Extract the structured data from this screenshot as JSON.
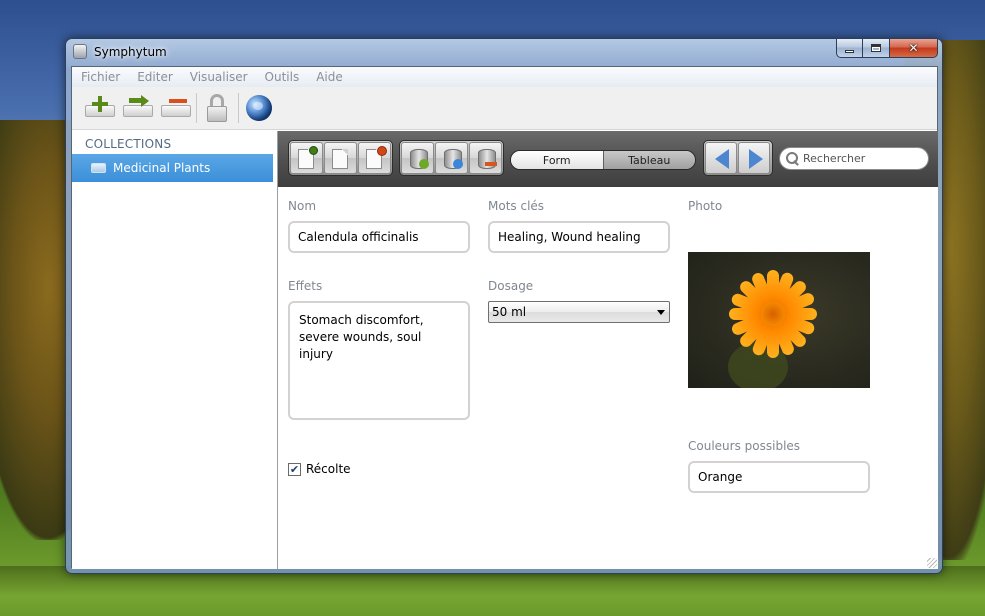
{
  "window": {
    "title": "Symphytum",
    "controls": {
      "minimize_icon": "minimize-icon",
      "maximize_icon": "maximize-icon",
      "close_icon": "close-icon"
    }
  },
  "menubar": {
    "items": [
      "Fichier",
      "Editer",
      "Visualiser",
      "Outils",
      "Aide"
    ]
  },
  "toolbar": {
    "buttons": [
      {
        "icon": "add-collection-icon"
      },
      {
        "icon": "move-collection-icon"
      },
      {
        "icon": "remove-collection-icon"
      },
      {
        "icon": "lock-icon"
      },
      {
        "icon": "globe-icon"
      }
    ]
  },
  "sidebar": {
    "header": "COLLECTIONS",
    "items": [
      {
        "label": "Medicinal Plants",
        "icon": "collection-icon",
        "selected": true
      }
    ],
    "selected_color": "#3b8fd8"
  },
  "panelbar": {
    "record_buttons": [
      "new-record-icon",
      "duplicate-record-icon",
      "delete-record-icon"
    ],
    "field_buttons": [
      "add-field-icon",
      "edit-field-icon",
      "remove-field-icon"
    ],
    "view_toggle": {
      "options": [
        "Form",
        "Tableau"
      ],
      "selected": "Form"
    },
    "nav": {
      "prev_icon": "arrow-left-icon",
      "next_icon": "arrow-right-icon"
    },
    "search": {
      "placeholder": "Rechercher",
      "icon": "search-icon"
    }
  },
  "form": {
    "nom": {
      "label": "Nom",
      "value": "Calendula officinalis"
    },
    "mots_cles": {
      "label": "Mots clés",
      "value": "Healing, Wound healing"
    },
    "photo": {
      "label": "Photo"
    },
    "effets": {
      "label": "Effets",
      "value": "Stomach discomfort, severe wounds, soul injury"
    },
    "dosage": {
      "label": "Dosage",
      "value": "50 ml"
    },
    "recolte": {
      "label": "Récolte",
      "checked": true
    },
    "couleurs": {
      "label": "Couleurs possibles",
      "value": "Orange"
    }
  }
}
